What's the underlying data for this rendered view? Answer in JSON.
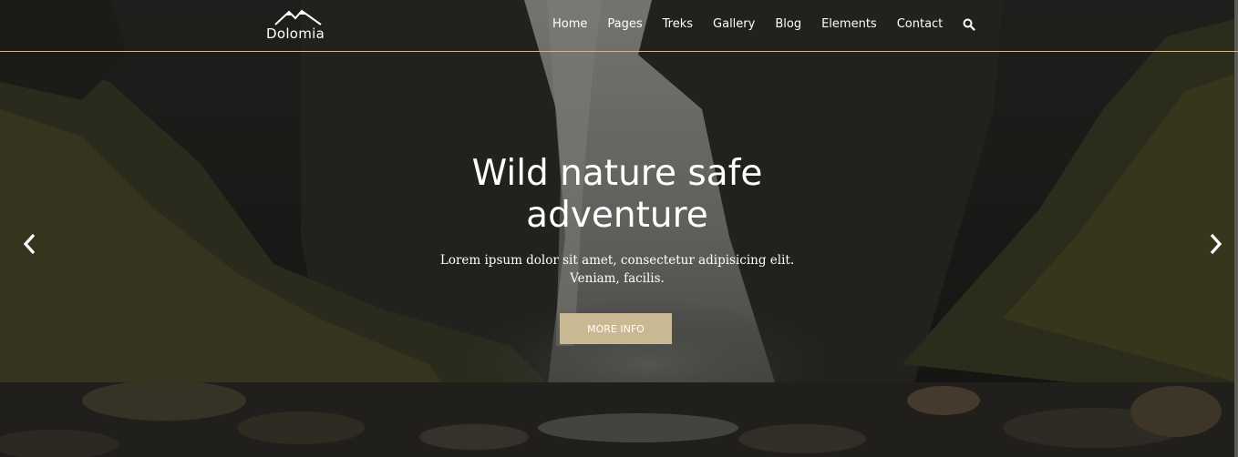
{
  "brand": {
    "name": "Dolomia",
    "icon": "mountain-logo-icon"
  },
  "nav": {
    "items": [
      {
        "label": "Home"
      },
      {
        "label": "Pages"
      },
      {
        "label": "Treks"
      },
      {
        "label": "Gallery"
      },
      {
        "label": "Blog"
      },
      {
        "label": "Elements"
      },
      {
        "label": "Contact"
      }
    ],
    "search_icon": "search-icon"
  },
  "hero": {
    "title_line1": "Wild nature safe",
    "title_line2": "adventure",
    "description": "Lorem ipsum dolor sit amet, consectetur adipisicing elit. Veniam, facilis.",
    "cta_label": "MORE INFO",
    "prev_icon": "chevron-left-icon",
    "next_icon": "chevron-right-icon"
  },
  "colors": {
    "accent": "#c8b893",
    "divider": "#c9b98f",
    "text": "#ffffff"
  }
}
